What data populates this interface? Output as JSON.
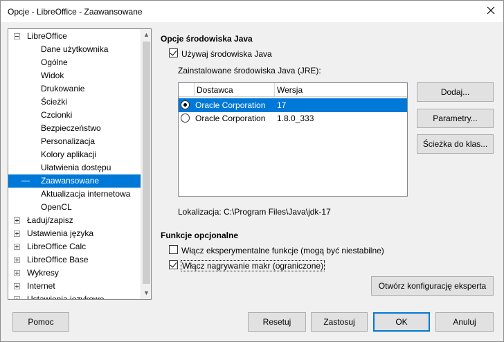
{
  "window": {
    "title": "Opcje - LibreOffice - Zaawansowane"
  },
  "tree": {
    "items": [
      {
        "label": "LibreOffice",
        "level": 0,
        "expander": "minus"
      },
      {
        "label": "Dane użytkownika",
        "level": 1
      },
      {
        "label": "Ogólne",
        "level": 1
      },
      {
        "label": "Widok",
        "level": 1
      },
      {
        "label": "Drukowanie",
        "level": 1
      },
      {
        "label": "Ścieżki",
        "level": 1
      },
      {
        "label": "Czcionki",
        "level": 1
      },
      {
        "label": "Bezpieczeństwo",
        "level": 1
      },
      {
        "label": "Personalizacja",
        "level": 1
      },
      {
        "label": "Kolory aplikacji",
        "level": 1
      },
      {
        "label": "Ułatwienia dostępu",
        "level": 1
      },
      {
        "label": "Zaawansowane",
        "level": 1,
        "selected": true
      },
      {
        "label": "Aktualizacja internetowa",
        "level": 1
      },
      {
        "label": "OpenCL",
        "level": 1
      },
      {
        "label": "Ładuj/zapisz",
        "level": 0,
        "expander": "plus"
      },
      {
        "label": "Ustawienia języka",
        "level": 0,
        "expander": "plus"
      },
      {
        "label": "LibreOffice Calc",
        "level": 0,
        "expander": "plus"
      },
      {
        "label": "LibreOffice Base",
        "level": 0,
        "expander": "plus"
      },
      {
        "label": "Wykresy",
        "level": 0,
        "expander": "plus"
      },
      {
        "label": "Internet",
        "level": 0,
        "expander": "plus"
      },
      {
        "label": "Ustawienia językowe",
        "level": 0,
        "expander": "plus"
      }
    ]
  },
  "java": {
    "section_title": "Opcje środowiska Java",
    "use_java_label": "Używaj środowiska Java",
    "use_java_checked": true,
    "installed_label": "Zainstalowane środowiska Java (JRE):",
    "columns": [
      "Dostawca",
      "Wersja"
    ],
    "rows": [
      {
        "vendor": "Oracle Corporation",
        "version": "17",
        "selected": true
      },
      {
        "vendor": "Oracle Corporation",
        "version": "1.8.0_333",
        "selected": false
      }
    ],
    "location": "Lokalizacja: C:\\Program Files\\Java\\jdk-17",
    "buttons": {
      "add": "Dodaj...",
      "parameters": "Parametry...",
      "classpath": "Ścieżka do klas..."
    }
  },
  "optional": {
    "section_title": "Funkcje opcjonalne",
    "experimental_label": "Włącz eksperymentalne funkcje (mogą być niestabilne)",
    "experimental_checked": false,
    "macro_label": "Włącz nagrywanie makr (ograniczone)",
    "macro_checked": true,
    "expert_button": "Otwórz konfigurację eksperta"
  },
  "footer": {
    "help": "Pomoc",
    "reset": "Resetuj",
    "apply": "Zastosuj",
    "ok": "OK",
    "cancel": "Anuluj"
  },
  "colors": {
    "selection": "#0078d7"
  }
}
